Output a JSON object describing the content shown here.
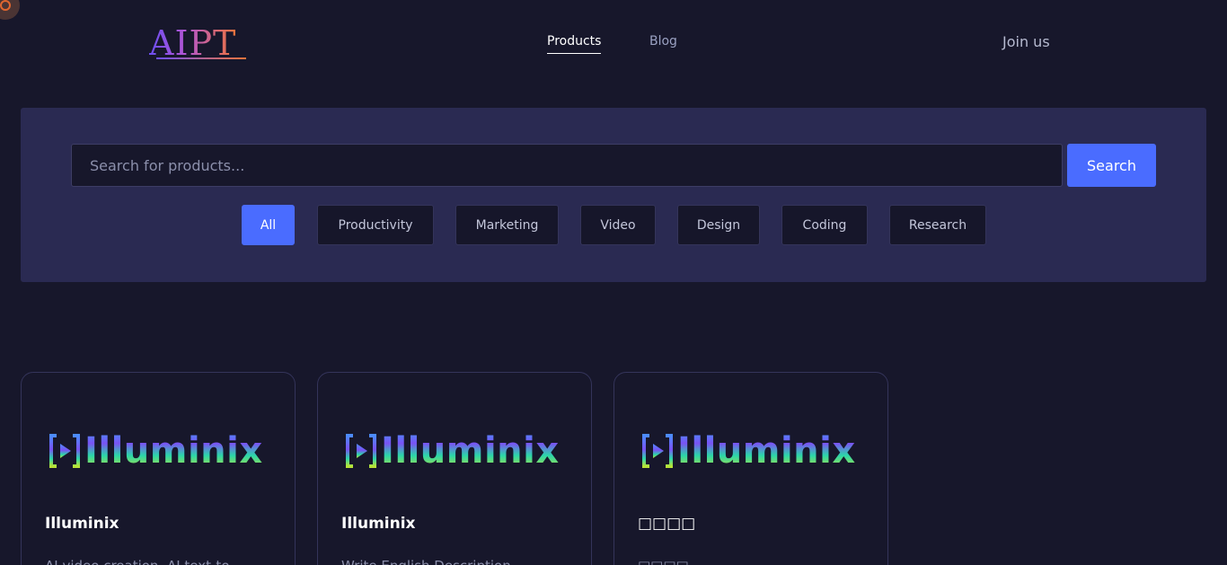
{
  "header": {
    "logo_text": "AIPT",
    "nav": {
      "products_label": "Products",
      "blog_label": "Blog"
    },
    "join_label": "Join us"
  },
  "search": {
    "placeholder": "Search for products...",
    "value": "",
    "button_label": "Search"
  },
  "filters": {
    "items": [
      {
        "label": "All",
        "active": true
      },
      {
        "label": "Productivity",
        "active": false
      },
      {
        "label": "Marketing",
        "active": false
      },
      {
        "label": "Video",
        "active": false
      },
      {
        "label": "Design",
        "active": false
      },
      {
        "label": "Coding",
        "active": false
      },
      {
        "label": "Research",
        "active": false
      }
    ]
  },
  "products": [
    {
      "logo_text": "Illuminix",
      "title": "Illuminix",
      "description": "AI video creation, AI text-to..."
    },
    {
      "logo_text": "Illuminix",
      "title": "Illuminix",
      "description": "Write English Description"
    },
    {
      "logo_text": "Illuminix",
      "title": "□□□□",
      "description": "□□□□"
    }
  ],
  "colors": {
    "background": "#17172b",
    "panel": "#2a2a52",
    "accent": "#4a6cff",
    "text_primary": "#ffffff",
    "text_muted": "#8b8fab"
  }
}
